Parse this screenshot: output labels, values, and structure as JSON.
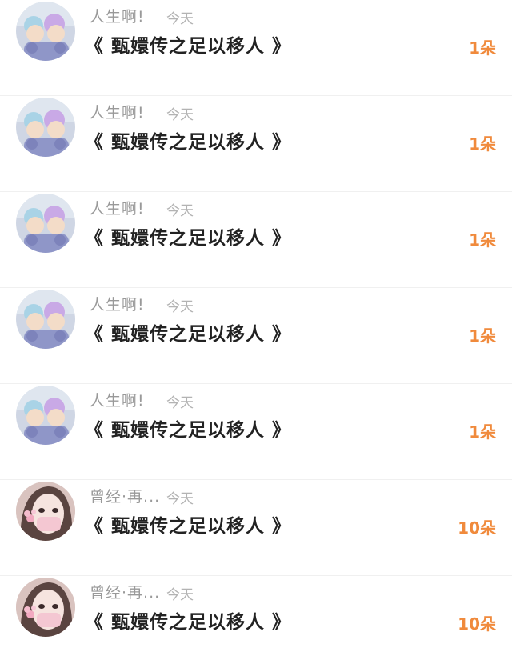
{
  "colors": {
    "username": "#999999",
    "time": "#b3b3b3",
    "title": "#222222",
    "count": "#f08a3c",
    "divider": "#f0f0f0"
  },
  "rows": [
    {
      "username": "人生啊!",
      "time": "今天",
      "title": "《 甄嬛传之足以移人 》",
      "count": "1朵",
      "avatar": "doll-avatar-icon"
    },
    {
      "username": "人生啊!",
      "time": "今天",
      "title": "《 甄嬛传之足以移人 》",
      "count": "1朵",
      "avatar": "doll-avatar-icon"
    },
    {
      "username": "人生啊!",
      "time": "今天",
      "title": "《 甄嬛传之足以移人 》",
      "count": "1朵",
      "avatar": "doll-avatar-icon"
    },
    {
      "username": "人生啊!",
      "time": "今天",
      "title": "《 甄嬛传之足以移人 》",
      "count": "1朵",
      "avatar": "doll-avatar-icon"
    },
    {
      "username": "人生啊!",
      "time": "今天",
      "title": "《 甄嬛传之足以移人 》",
      "count": "1朵",
      "avatar": "doll-avatar-icon"
    },
    {
      "username": "曾经·再...",
      "time": "今天",
      "title": "《 甄嬛传之足以移人 》",
      "count": "10朵",
      "avatar": "girl-avatar-icon"
    },
    {
      "username": "曾经·再...",
      "time": "今天",
      "title": "《 甄嬛传之足以移人 》",
      "count": "10朵",
      "avatar": "girl-avatar-icon"
    }
  ]
}
